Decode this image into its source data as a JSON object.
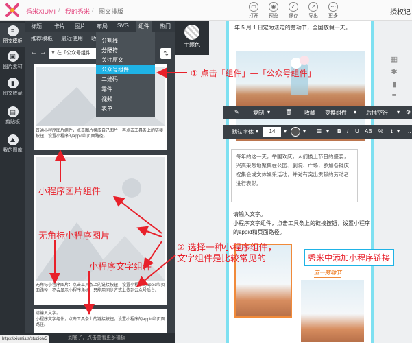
{
  "app": {
    "brand": "秀米XIUMI",
    "breadcrumb": [
      "我的秀米",
      "图文排版"
    ],
    "toolbar": [
      "打开",
      "预览",
      "保存",
      "导出",
      "更多"
    ],
    "authorize_label": "授权记"
  },
  "rail": [
    {
      "label": "图文模板",
      "icon": "template-icon"
    },
    {
      "label": "图片素材",
      "icon": "image-icon"
    },
    {
      "label": "图文收藏",
      "icon": "bookmark-icon"
    },
    {
      "label": "剪贴板",
      "icon": "clipboard-icon"
    },
    {
      "label": "我的图库",
      "icon": "gallery-icon"
    }
  ],
  "panel": {
    "tabs": [
      "标题",
      "卡片",
      "图片",
      "布局",
      "SVG",
      "组件",
      "热门"
    ],
    "active_tab": "组件",
    "subtabs": [
      "推荐模板",
      "最近使用",
      "收"
    ],
    "filter_value": "在「公众号组件",
    "card1_text": "普通小程序图片组件，点击图片换成自己图片，再点击工具条上的链接按钮，设置小程序的appid和页面路径。",
    "card2_text": "无角标小程序图片：点击工具条上的链接按钮，设置小程序的appid和页面路径，不会显示小程序角标。只能用同步方式上传到公众号后台。",
    "card3_text1": "请输入文字。",
    "card3_text2": "小程序文字组件，点击工具条上的链接按钮，设置小程序的appid和页面路径。",
    "footer": "到底了，点击查看更多模板",
    "status_url": "https://xiumi.us/studio/v5"
  },
  "dropdown": {
    "items": [
      "分割线",
      "分隔符",
      "关注原文",
      "公众号组件",
      "二维码",
      "零件",
      "视频",
      "表单"
    ],
    "active": "公众号组件"
  },
  "theme_label": "主题色",
  "editor": {
    "top_text": "年 5 月 1 日定为法定的劳动节，全国放假一天。",
    "toolbar1": [
      "复制",
      "收藏",
      "变换组件",
      "后插空行"
    ],
    "toolbar2": {
      "font": "默认字体",
      "size": "14",
      "buttons": [
        "B",
        "I",
        "U",
        "AB",
        "%"
      ]
    },
    "textbox": "每年的这一天，举国欢庆，人们换上节日的盛装，兴高采烈地聚集在公园、剧院、广场，参加各种庆祝集会或文体娱乐活动，并对有突出贡献的劳动者进行表彰。",
    "text_label": "请输入文字。",
    "text_body": "小程序文字组件，点击工具条上的链接按钮，设置小程序的appid和页面路径。",
    "caption": "五一劳动节"
  },
  "annotations": {
    "step1": "① 点击「组件」—「公众号组件」",
    "img_component": "小程序图片组件",
    "no_corner": "无角标小程序图片",
    "text_component": "小程序文字组件",
    "step2_line1": "② 选择一种小程序组件，",
    "step2_line2": "文字组件是比较常见的",
    "add_link": "秀米中添加小程序链接"
  },
  "colors": {
    "brand": "#e3457e",
    "panel_bg": "#3a4046",
    "rail_bg": "#2b3035",
    "highlight": "#1fb3e6",
    "annotation": "#e8202a",
    "doc_border": "#7ee0f1"
  }
}
